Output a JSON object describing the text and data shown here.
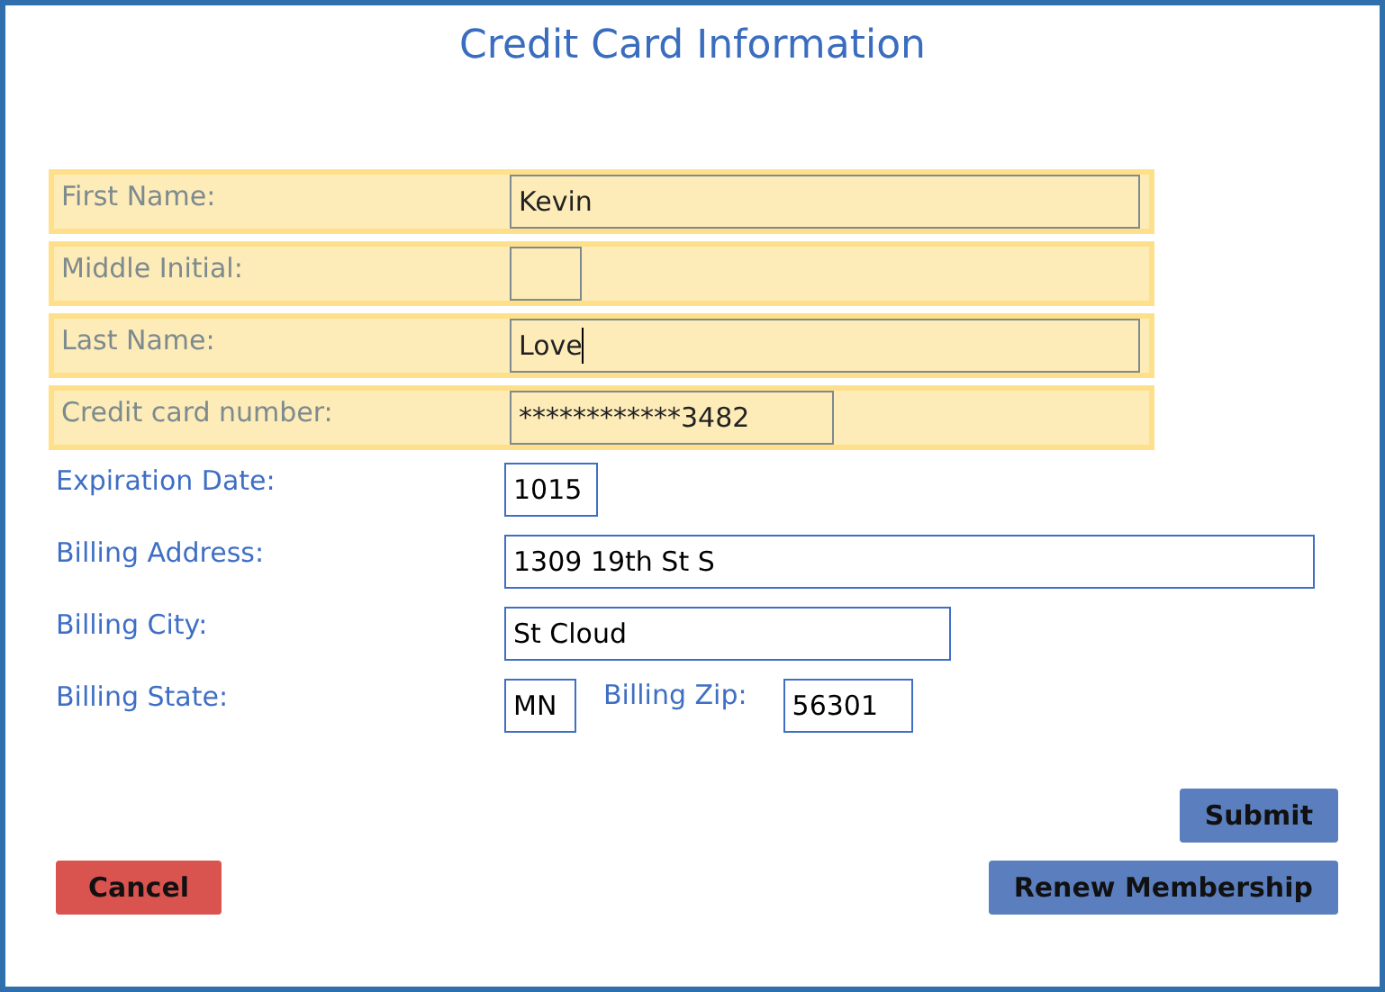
{
  "title": "Credit Card Information",
  "rows": [
    {
      "label": "First Name:",
      "highlighted": true,
      "fields": [
        {
          "value": "Kevin",
          "focused": false
        }
      ]
    },
    {
      "label": "Middle Initial:",
      "highlighted": true,
      "fields": [
        {
          "focused": false
        }
      ]
    },
    {
      "label": "Last Name:",
      "highlighted": true,
      "fields": [
        {
          "value": "Love",
          "focused": true
        }
      ]
    },
    {
      "label": "Credit card number:",
      "highlighted": true,
      "fields": [
        {
          "value": "************3482",
          "focused": false
        }
      ]
    },
    {
      "label": "Expiration Date:",
      "highlighted": false,
      "fields": [
        {
          "value": "1015",
          "focused": false
        }
      ]
    },
    {
      "label": "Billing Address:",
      "highlighted": false,
      "fields": [
        {
          "value": "1309 19th St S",
          "focused": false
        }
      ]
    },
    {
      "label": "Billing City:",
      "highlighted": false,
      "fields": [
        {
          "value": "St Cloud",
          "focused": false
        }
      ]
    },
    {
      "label": "Billing State:",
      "highlighted": false,
      "fields": [
        {
          "value": "MN",
          "focused": false
        },
        {
          "label": "Billing Zip:",
          "value": "56301",
          "focused": false
        }
      ]
    }
  ],
  "buttons": [
    {
      "label": "Submit",
      "kind": "primary"
    },
    {
      "label": "Cancel",
      "kind": "danger"
    },
    {
      "label": "Renew Membership",
      "kind": "primary"
    }
  ]
}
